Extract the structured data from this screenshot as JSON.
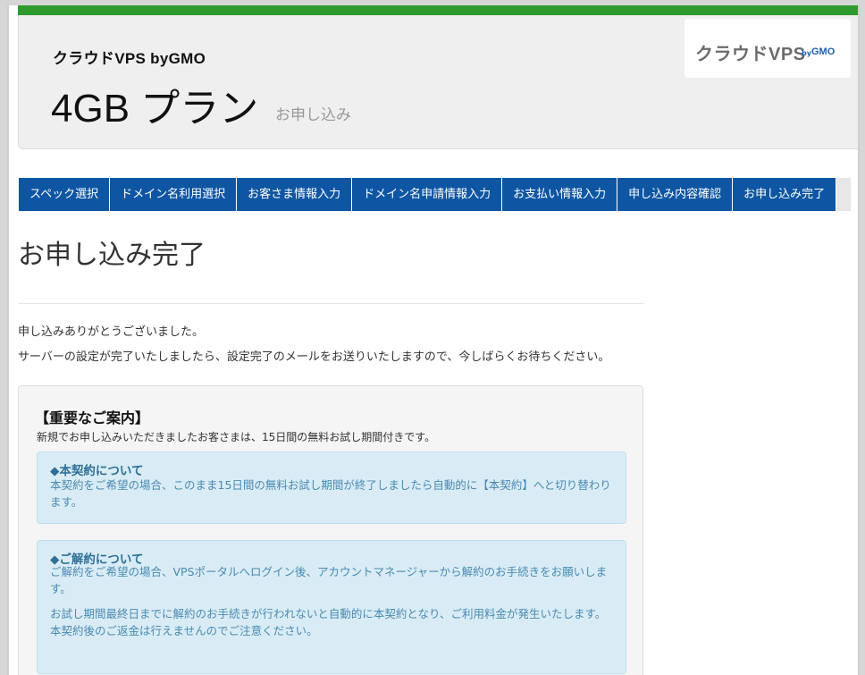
{
  "header": {
    "brand": "クラウドVPS byGMO",
    "plan_title": "4GB プラン",
    "plan_subtitle": "お申し込み",
    "logo": {
      "main": "クラウドVPS",
      "by": "by",
      "gmo": "GMO"
    }
  },
  "nav": {
    "steps": [
      "スペック選択",
      "ドメイン名利用選択",
      "お客さま情報入力",
      "ドメイン名申請情報入力",
      "お支払い情報入力",
      "申し込み内容確認",
      "お申し込み完了"
    ]
  },
  "main": {
    "title": "お申し込み完了",
    "message_1": "申し込みありがとうございました。",
    "message_2": "サーバーの設定が完了いたしましたら、設定完了のメールをお送りいたしますので、今しばらくお待ちください。"
  },
  "notice": {
    "title": "【重要なご案内】",
    "intro": "新規でお申し込みいただきましたお客さまは、15日間の無料お試し期間付きです。",
    "box1": {
      "heading": "◆本契約について",
      "body": "本契約をご希望の場合、このまま15日間の無料お試し期間が終了しましたら自動的に【本契約】へと切り替わります。"
    },
    "box2": {
      "heading": "◆ご解約について",
      "body_1": "ご解約をご希望の場合、VPSポータルへログイン後、アカウントマネージャーから解約のお手続きをお願いします。",
      "body_2": "お試し期間最終日までに解約のお手続きが行われないと自動的に本契約となり、ご利用料金が発生いたします。",
      "body_3": "本契約後のご返金は行えませんのでご注意ください。"
    }
  },
  "colors": {
    "accent_green": "#2e9a2e",
    "nav_blue": "#0e56a3",
    "info_bg": "#d9ecf5"
  }
}
